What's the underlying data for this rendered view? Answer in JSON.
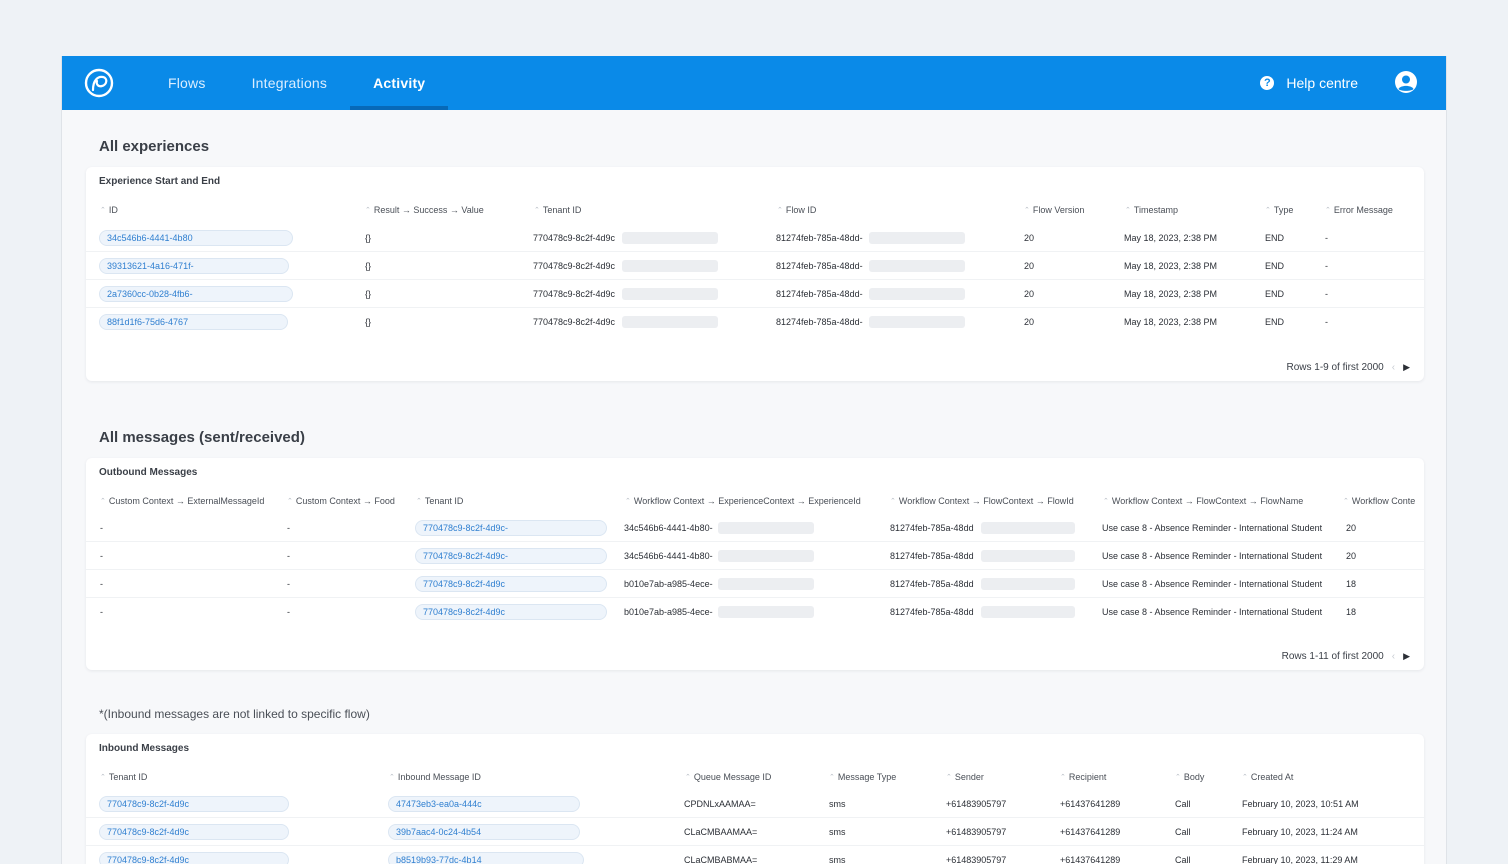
{
  "nav": {
    "items": [
      {
        "label": "Flows"
      },
      {
        "label": "Integrations"
      },
      {
        "label": "Activity"
      }
    ],
    "help_label": "Help centre",
    "accent": "#0a8ae8"
  },
  "experiences": {
    "section_title": "All experiences",
    "card_title": "Experience Start and End",
    "columns": [
      "ID",
      "Result → Success → Value",
      "Tenant ID",
      "Flow ID",
      "Flow Version",
      "Timestamp",
      "Type",
      "Error Message"
    ],
    "rows": [
      {
        "id": "34c546b6-4441-4b80",
        "result": "{}",
        "tenant": "770478c9-8c2f-4d9c",
        "flow": "81274feb-785a-48dd-",
        "version": "20",
        "timestamp": "May 18, 2023, 2:38 PM",
        "type": "END",
        "error": "-"
      },
      {
        "id": "39313621-4a16-471f-",
        "result": "{}",
        "tenant": "770478c9-8c2f-4d9c",
        "flow": "81274feb-785a-48dd-",
        "version": "20",
        "timestamp": "May 18, 2023, 2:38 PM",
        "type": "END",
        "error": "-"
      },
      {
        "id": "2a7360cc-0b28-4fb6-",
        "result": "{}",
        "tenant": "770478c9-8c2f-4d9c",
        "flow": "81274feb-785a-48dd-",
        "version": "20",
        "timestamp": "May 18, 2023, 2:38 PM",
        "type": "END",
        "error": "-"
      },
      {
        "id": "88f1d1f6-75d6-4767",
        "result": "{}",
        "tenant": "770478c9-8c2f-4d9c",
        "flow": "81274feb-785a-48dd-",
        "version": "20",
        "timestamp": "May 18, 2023, 2:38 PM",
        "type": "END",
        "error": "-"
      }
    ],
    "pager": "Rows 1-9 of first 2000"
  },
  "messages": {
    "section_title": "All messages (sent/received)",
    "card_title": "Outbound Messages",
    "columns": [
      "Custom Context → ExternalMessageId",
      "Custom Context → Food",
      "Tenant ID",
      "Workflow Context → ExperienceContext → ExperienceId",
      "Workflow Context → FlowContext → FlowId",
      "Workflow Context → FlowContext → FlowName",
      "Workflow Conte"
    ],
    "rows": [
      {
        "external": "-",
        "food": "-",
        "tenant": "770478c9-8c2f-4d9c-",
        "experience": "34c546b6-4441-4b80-",
        "flow_id": "81274feb-785a-48dd",
        "flow_name": "Use case 8 - Absence Reminder - International Student",
        "version": "20"
      },
      {
        "external": "-",
        "food": "-",
        "tenant": "770478c9-8c2f-4d9c-",
        "experience": "34c546b6-4441-4b80-",
        "flow_id": "81274feb-785a-48dd",
        "flow_name": "Use case 8 - Absence Reminder - International Student",
        "version": "20"
      },
      {
        "external": "-",
        "food": "-",
        "tenant": "770478c9-8c2f-4d9c",
        "experience": "b010e7ab-a985-4ece-",
        "flow_id": "81274feb-785a-48dd",
        "flow_name": "Use case 8 - Absence Reminder - International Student",
        "version": "18"
      },
      {
        "external": "-",
        "food": "-",
        "tenant": "770478c9-8c2f-4d9c",
        "experience": "b010e7ab-a985-4ece-",
        "flow_id": "81274feb-785a-48dd",
        "flow_name": "Use case 8 - Absence Reminder - International Student",
        "version": "18"
      }
    ],
    "pager": "Rows 1-11 of first 2000"
  },
  "inbound": {
    "note": "*(Inbound messages are not linked to specific flow)",
    "card_title": "Inbound Messages",
    "columns": [
      "Tenant ID",
      "Inbound Message ID",
      "Queue Message ID",
      "Message Type",
      "Sender",
      "Recipient",
      "Body",
      "Created At"
    ],
    "rows": [
      {
        "tenant": "770478c9-8c2f-4d9c",
        "inbound_id": "47473eb3-ea0a-444c",
        "queue_id": "CPDNLxAAMAA=",
        "type": "sms",
        "sender": "+61483905797",
        "recipient": "+61437641289",
        "body": "Call",
        "created": "February 10, 2023, 10:51 AM"
      },
      {
        "tenant": "770478c9-8c2f-4d9c",
        "inbound_id": "39b7aac4-0c24-4b54",
        "queue_id": "CLaCMBAAMAA=",
        "type": "sms",
        "sender": "+61483905797",
        "recipient": "+61437641289",
        "body": "Call",
        "created": "February 10, 2023, 11:24 AM"
      },
      {
        "tenant": "770478c9-8c2f-4d9c",
        "inbound_id": "b8519b93-77dc-4b14",
        "queue_id": "CLaCMBABMAA=",
        "type": "sms",
        "sender": "+61483905797",
        "recipient": "+61437641289",
        "body": "Call",
        "created": "February 10, 2023, 11:29 AM"
      }
    ]
  }
}
